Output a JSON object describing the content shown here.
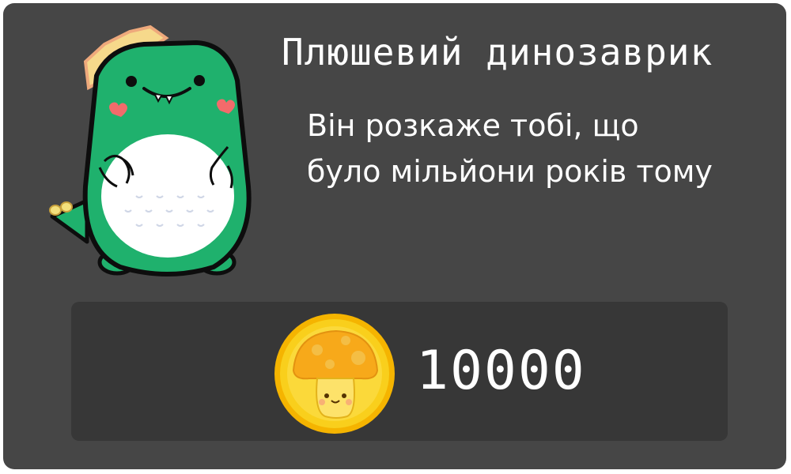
{
  "item": {
    "title": "Плюшевий динозаврик",
    "description": "Він розкаже тобі, що було мільйони років тому",
    "price": "10000",
    "image_icon": "plush-dinosaur-icon",
    "currency_icon": "mushroom-coin-icon"
  },
  "colors": {
    "card_background": "#464646",
    "panel_background": "#373737",
    "dino_green": "#1fb16d",
    "coin_gold": "#f7c81a"
  }
}
